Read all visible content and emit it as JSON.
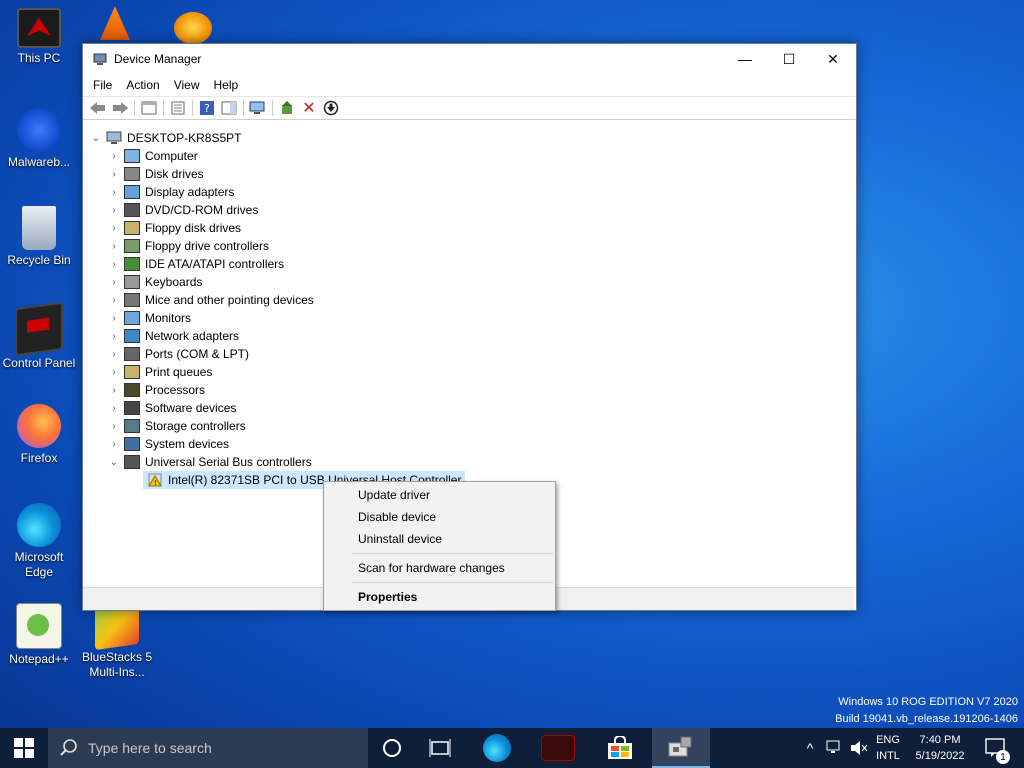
{
  "desktop": {
    "icons": [
      {
        "label": "This PC"
      },
      {
        "label": "Malwareb..."
      },
      {
        "label": "Recycle Bin"
      },
      {
        "label": "Control Panel"
      },
      {
        "label": "Firefox"
      },
      {
        "label": "Microsoft Edge"
      },
      {
        "label": "Notepad++"
      },
      {
        "label": "BlueStacks 5 Multi-Ins..."
      }
    ],
    "watermark_line1": "Windows 10 ROG EDITION V7 2020",
    "watermark_line2": "Build 19041.vb_release.191206-1406"
  },
  "window": {
    "title": "Device Manager",
    "minimize": "—",
    "maximize": "☐",
    "close": "✕",
    "menu": [
      "File",
      "Action",
      "View",
      "Help"
    ],
    "root": "DESKTOP-KR8S5PT",
    "categories": [
      "Computer",
      "Disk drives",
      "Display adapters",
      "DVD/CD-ROM drives",
      "Floppy disk drives",
      "Floppy drive controllers",
      "IDE ATA/ATAPI controllers",
      "Keyboards",
      "Mice and other pointing devices",
      "Monitors",
      "Network adapters",
      "Ports (COM & LPT)",
      "Print queues",
      "Processors",
      "Software devices",
      "Storage controllers",
      "System devices",
      "Universal Serial Bus controllers"
    ],
    "selected_device": "Intel(R) 82371SB PCI to USB Universal Host Controller"
  },
  "context_menu": {
    "update": "Update driver",
    "disable": "Disable device",
    "uninstall": "Uninstall device",
    "scan": "Scan for hardware changes",
    "properties": "Properties"
  },
  "taskbar": {
    "search_placeholder": "Type here to search",
    "lang1": "ENG",
    "lang2": "INTL",
    "time": "7:40 PM",
    "date": "5/19/2022",
    "notif_count": "1"
  },
  "colors": {
    "selection": "#cce8ff",
    "taskbar": "#0f1f3a",
    "warning": "#f5c211"
  }
}
